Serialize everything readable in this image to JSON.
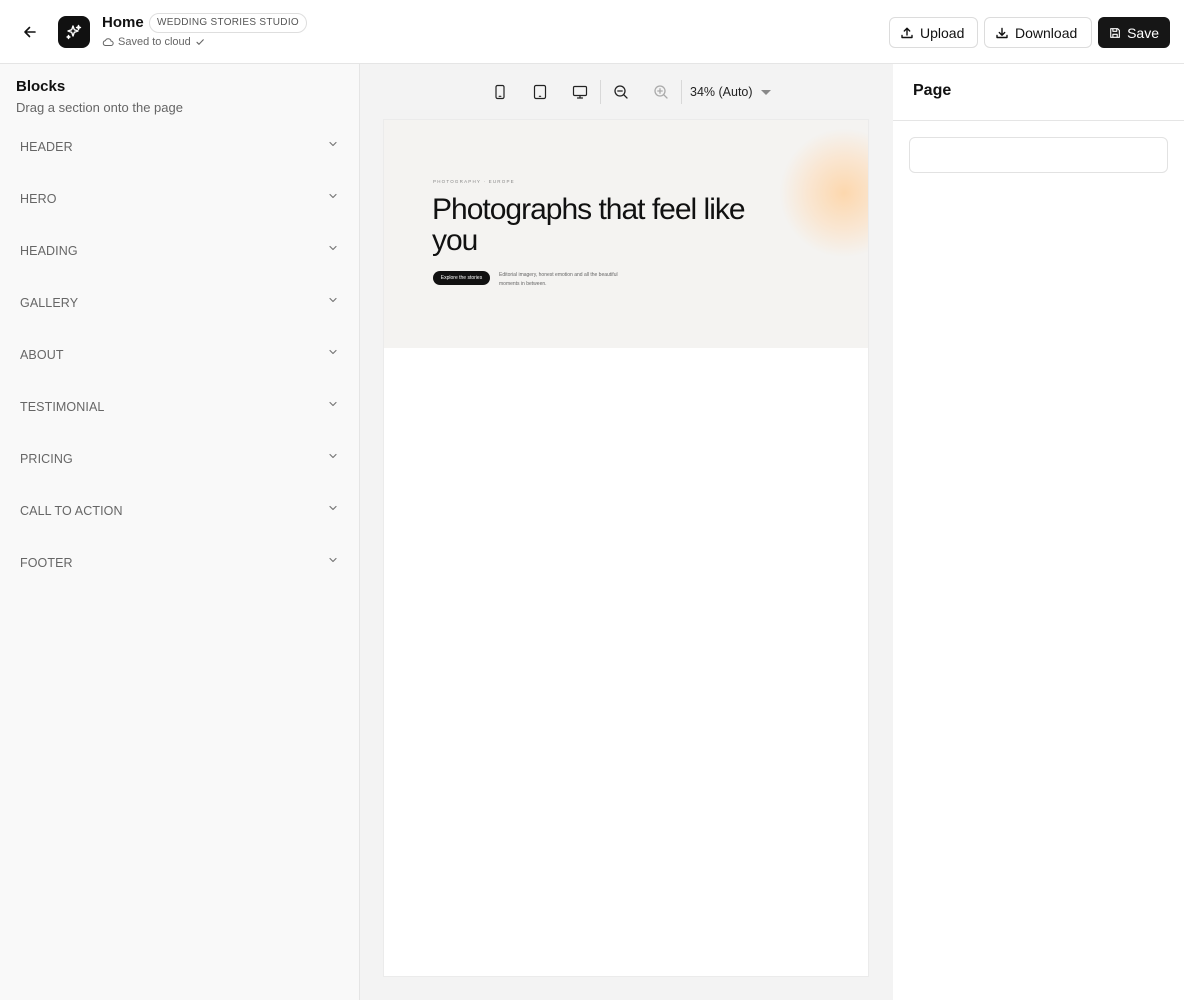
{
  "header": {
    "page_name": "Home",
    "studio_badge": "WEDDING STORIES STUDIO",
    "save_status": "Saved to cloud",
    "icons": {
      "back": "arrow-left-icon",
      "logo": "sparkles-icon",
      "cloud": "cloud-icon",
      "check": "check-icon"
    },
    "buttons": {
      "upload": "Upload",
      "download": "Download",
      "save": "Save"
    }
  },
  "sidebar": {
    "title": "Blocks",
    "subtitle": "Drag a section onto the page",
    "items": [
      {
        "label": "HEADER"
      },
      {
        "label": "HERO"
      },
      {
        "label": "HEADING"
      },
      {
        "label": "GALLERY"
      },
      {
        "label": "ABOUT"
      },
      {
        "label": "TESTIMONIAL"
      },
      {
        "label": "PRICING"
      },
      {
        "label": "CALL TO ACTION"
      },
      {
        "label": "FOOTER"
      }
    ]
  },
  "canvas": {
    "toolbar": {
      "devices": [
        "mobile-icon",
        "tablet-icon",
        "desktop-icon"
      ],
      "zoom_out": "zoom-out-icon",
      "zoom_in": "zoom-in-icon",
      "zoom_level": "34% (Auto)"
    },
    "preview": {
      "eyebrow": "PHOTOGRAPHY · EUROPE",
      "title": "Photographs that feel like you",
      "cta": "Explore the stories",
      "description": "Editorial imagery, honest emotion and all the beautiful moments in between."
    }
  },
  "right_panel": {
    "title": "Page"
  },
  "colors": {
    "accent": "#161616",
    "hero_bg": "#f4f3f1",
    "hero_glow": "#fdd6aa"
  }
}
